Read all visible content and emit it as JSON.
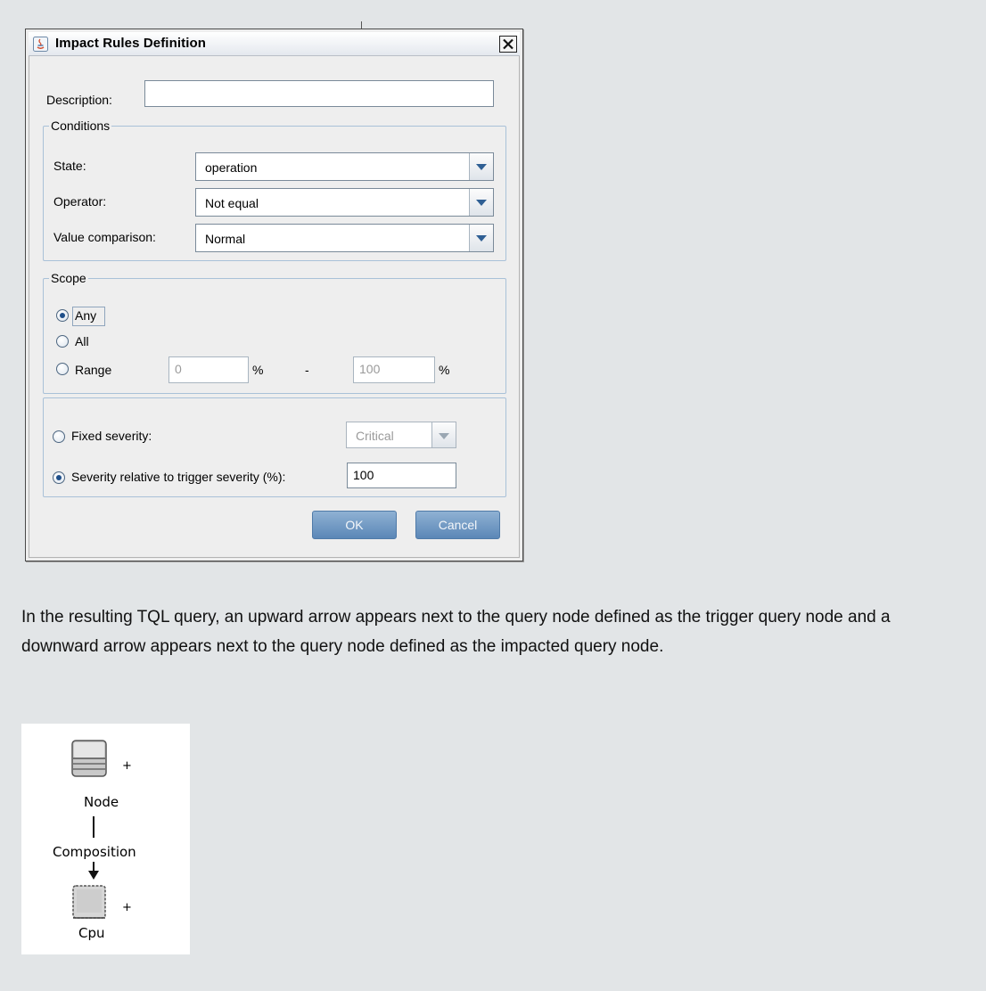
{
  "dialog": {
    "title": "Impact Rules Definition",
    "description": {
      "label": "Description:",
      "value": ""
    },
    "conditions": {
      "legend": "Conditions",
      "state": {
        "label": "State:",
        "value": "operation"
      },
      "operator": {
        "label": "Operator:",
        "value": "Not equal"
      },
      "value_comparison": {
        "label": "Value comparison:",
        "value": "Normal"
      }
    },
    "scope": {
      "legend": "Scope",
      "any_label": "Any",
      "all_label": "All",
      "range_label": "Range",
      "range_from": "0",
      "range_to": "100",
      "percent": "%",
      "dash": "-",
      "selected": "Any"
    },
    "severity": {
      "fixed_label": "Fixed severity:",
      "fixed_value": "Critical",
      "relative_label": "Severity relative to trigger severity (%):",
      "relative_value": "100",
      "selected": "relative"
    },
    "buttons": {
      "ok": "OK",
      "cancel": "Cancel"
    }
  },
  "paragraph": "In the resulting TQL query, an upward arrow appears next to the query node defined as the trigger query node and a downward arrow appears next to the query node defined as the impacted query node.",
  "diagram": {
    "top_node": "Node",
    "relation": "Composition",
    "bottom_node": "Cpu",
    "top_marker": "+",
    "bottom_marker": "+"
  }
}
